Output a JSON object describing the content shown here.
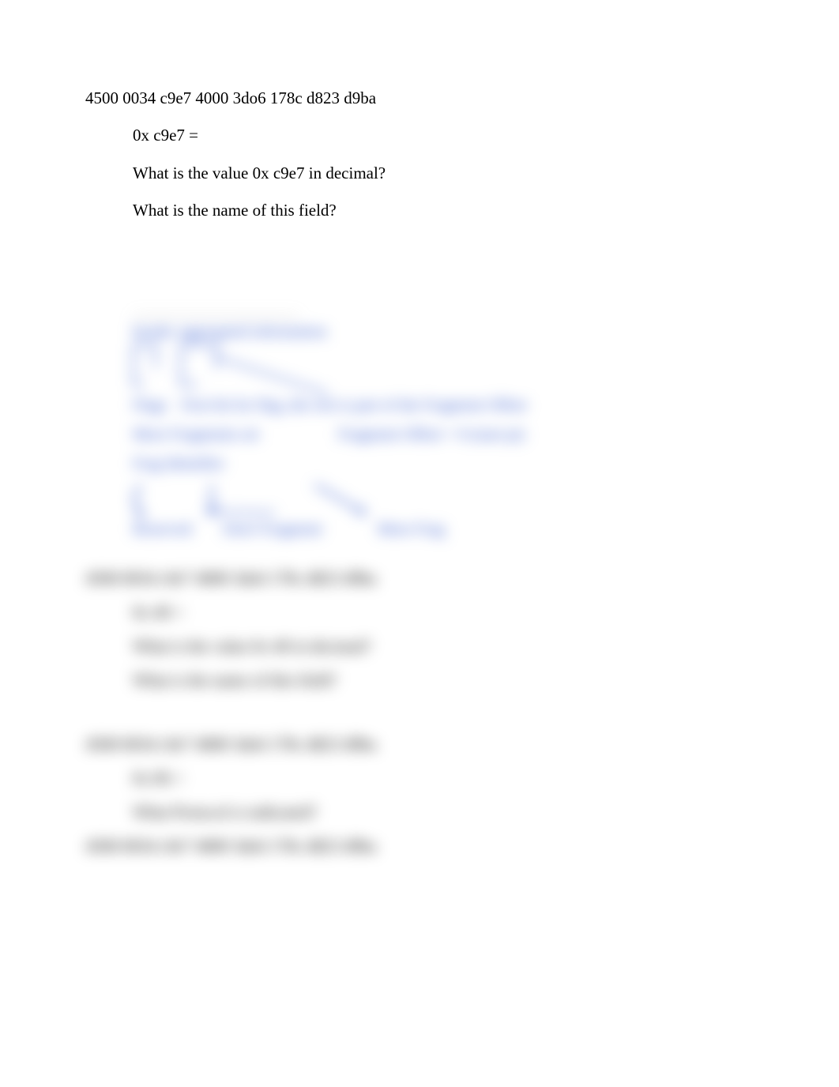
{
  "section1": {
    "hex_header": "4500 0034 c9e7 4000 3do6 178c d823 d9ba",
    "hex_pick": "0x c9e7 =",
    "q1": "What is the value 0x c9e7 in decimal?",
    "q2": "What is the name of this field?"
  },
  "diagram": {
    "header": "header aggregated information",
    "label_flags": "Flags",
    "label_rest": "First bit for flag, the rest is part of the Fragment Offset",
    "more_frag": "More Fragments set",
    "frag_offset": "Fragment Offset = 0 (start pt)",
    "frag_ident": "Frag Identifier",
    "arrow1_label": "Reserved",
    "arrow2_label": "Don't Fragment",
    "arrow3_label": "More Frag"
  },
  "section2": {
    "hex_header": "4500 0034 c9e7 4000 3do6 178c d823 d9ba",
    "hex_pick": "0x 40 =",
    "q1": "What is the value 0x 40 in decimal?",
    "q2": "What is the name of this field?"
  },
  "section3": {
    "hex_header": "4500 0034 c9e7 4000 3do6 178c d823 d9ba",
    "hex_pick": "0x 06 =",
    "q1": "What Protocol is indicated?",
    "hex_header2": "4500 0034 c9e7 4000 3do6 178c d823 d9ba"
  }
}
